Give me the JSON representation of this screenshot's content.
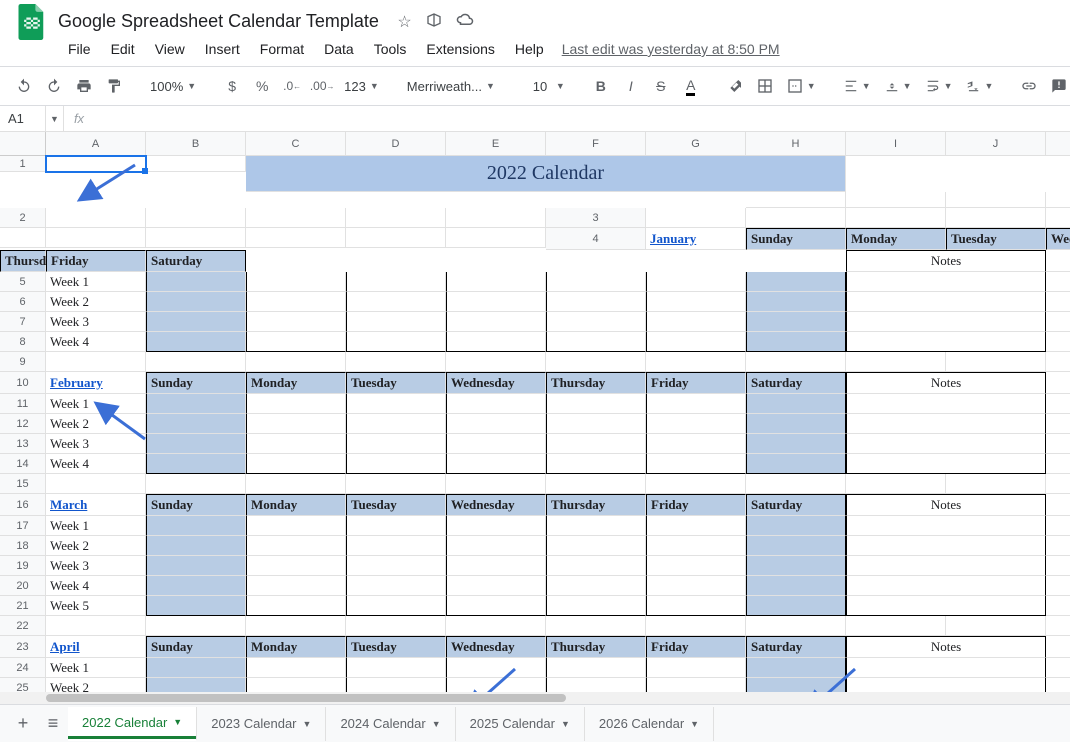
{
  "doc": {
    "title": "Google Spreadsheet Calendar Template"
  },
  "menu": {
    "file": "File",
    "edit": "Edit",
    "view": "View",
    "insert": "Insert",
    "format": "Format",
    "data": "Data",
    "tools": "Tools",
    "extensions": "Extensions",
    "help": "Help",
    "last_edit": "Last edit was yesterday at 8:50 PM"
  },
  "toolbar": {
    "zoom": "100%",
    "font": "Merriweath...",
    "size": "10"
  },
  "namebox": {
    "ref": "A1"
  },
  "columns": [
    "A",
    "B",
    "C",
    "D",
    "E",
    "F",
    "G",
    "H",
    "I",
    "J"
  ],
  "title_cell": "2022 Calendar",
  "day_headers": [
    "Sunday",
    "Monday",
    "Tuesday",
    "Wednesday",
    "Thursday",
    "Friday",
    "Saturday"
  ],
  "notes_label": "Notes",
  "months": [
    {
      "name": "January",
      "weeks": [
        "Week 1",
        "Week 2",
        "Week 3",
        "Week 4"
      ]
    },
    {
      "name": "February",
      "weeks": [
        "Week 1",
        "Week 2",
        "Week 3",
        "Week 4"
      ]
    },
    {
      "name": "March",
      "weeks": [
        "Week 1",
        "Week 2",
        "Week 3",
        "Week 4",
        "Week 5"
      ]
    },
    {
      "name": "April",
      "weeks": [
        "Week 1",
        "Week 2"
      ]
    }
  ],
  "tabs": {
    "active": "2022 Calendar",
    "others": [
      "2023 Calendar",
      "2024 Calendar",
      "2025 Calendar",
      "2026 Calendar"
    ]
  }
}
